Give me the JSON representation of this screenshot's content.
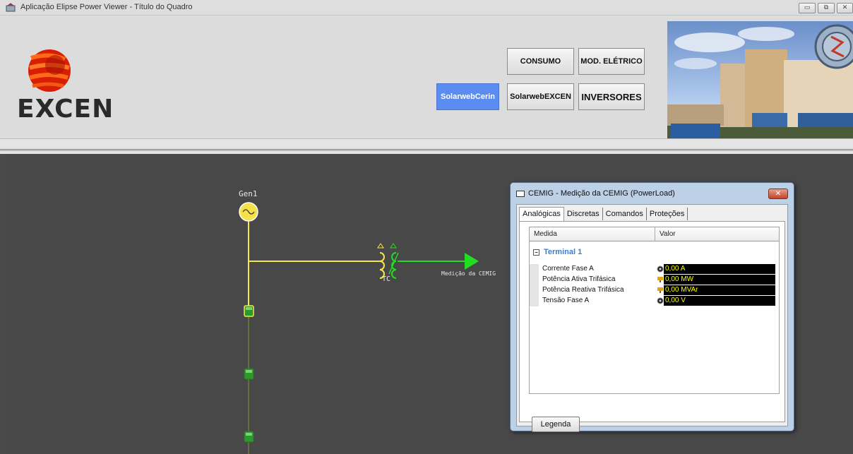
{
  "window": {
    "title": "Aplicação Elipse Power Viewer - Título do Quadro",
    "controls": [
      "minimize",
      "restore",
      "close"
    ]
  },
  "header": {
    "logo_text": "EXCEN",
    "buttons": [
      {
        "label": "CONSUMO",
        "active": false
      },
      {
        "label": "MOD. ELÉTRICO",
        "active": false
      },
      {
        "label": "SolarwebCerin",
        "active": true
      },
      {
        "label": "SolarwebEXCEN",
        "active": false
      },
      {
        "label": "INVERSORES",
        "active": false
      }
    ],
    "active_color": "#5b8cf2"
  },
  "diagram": {
    "generator_label": "Gen1",
    "tc_label": "TC",
    "measurement_label": "Medição da CEMIG",
    "line_color": "#f3e84a",
    "arrow_color": "#22dd22"
  },
  "dialog": {
    "title": "CEMIG - Medição da CEMIG (PowerLoad)",
    "tabs": [
      "Analógicas",
      "Discretas",
      "Comandos",
      "Proteções"
    ],
    "active_tab": "Analógicas",
    "columns": [
      "Medida",
      "Valor"
    ],
    "terminal": "Terminal 1",
    "rows": [
      {
        "name": "Corrente Fase A",
        "value": "0,00 A",
        "icon": "gauge-icon"
      },
      {
        "name": "Potência Ativa Trifásica",
        "value": "0,00 MW",
        "icon": "power-icon"
      },
      {
        "name": "Potência Reativa Trifásica",
        "value": "0,00 MVAr",
        "icon": "power-icon"
      },
      {
        "name": "Tensão Fase A",
        "value": "0,00 V",
        "icon": "gauge-icon"
      }
    ],
    "legend_button": "Legenda"
  }
}
